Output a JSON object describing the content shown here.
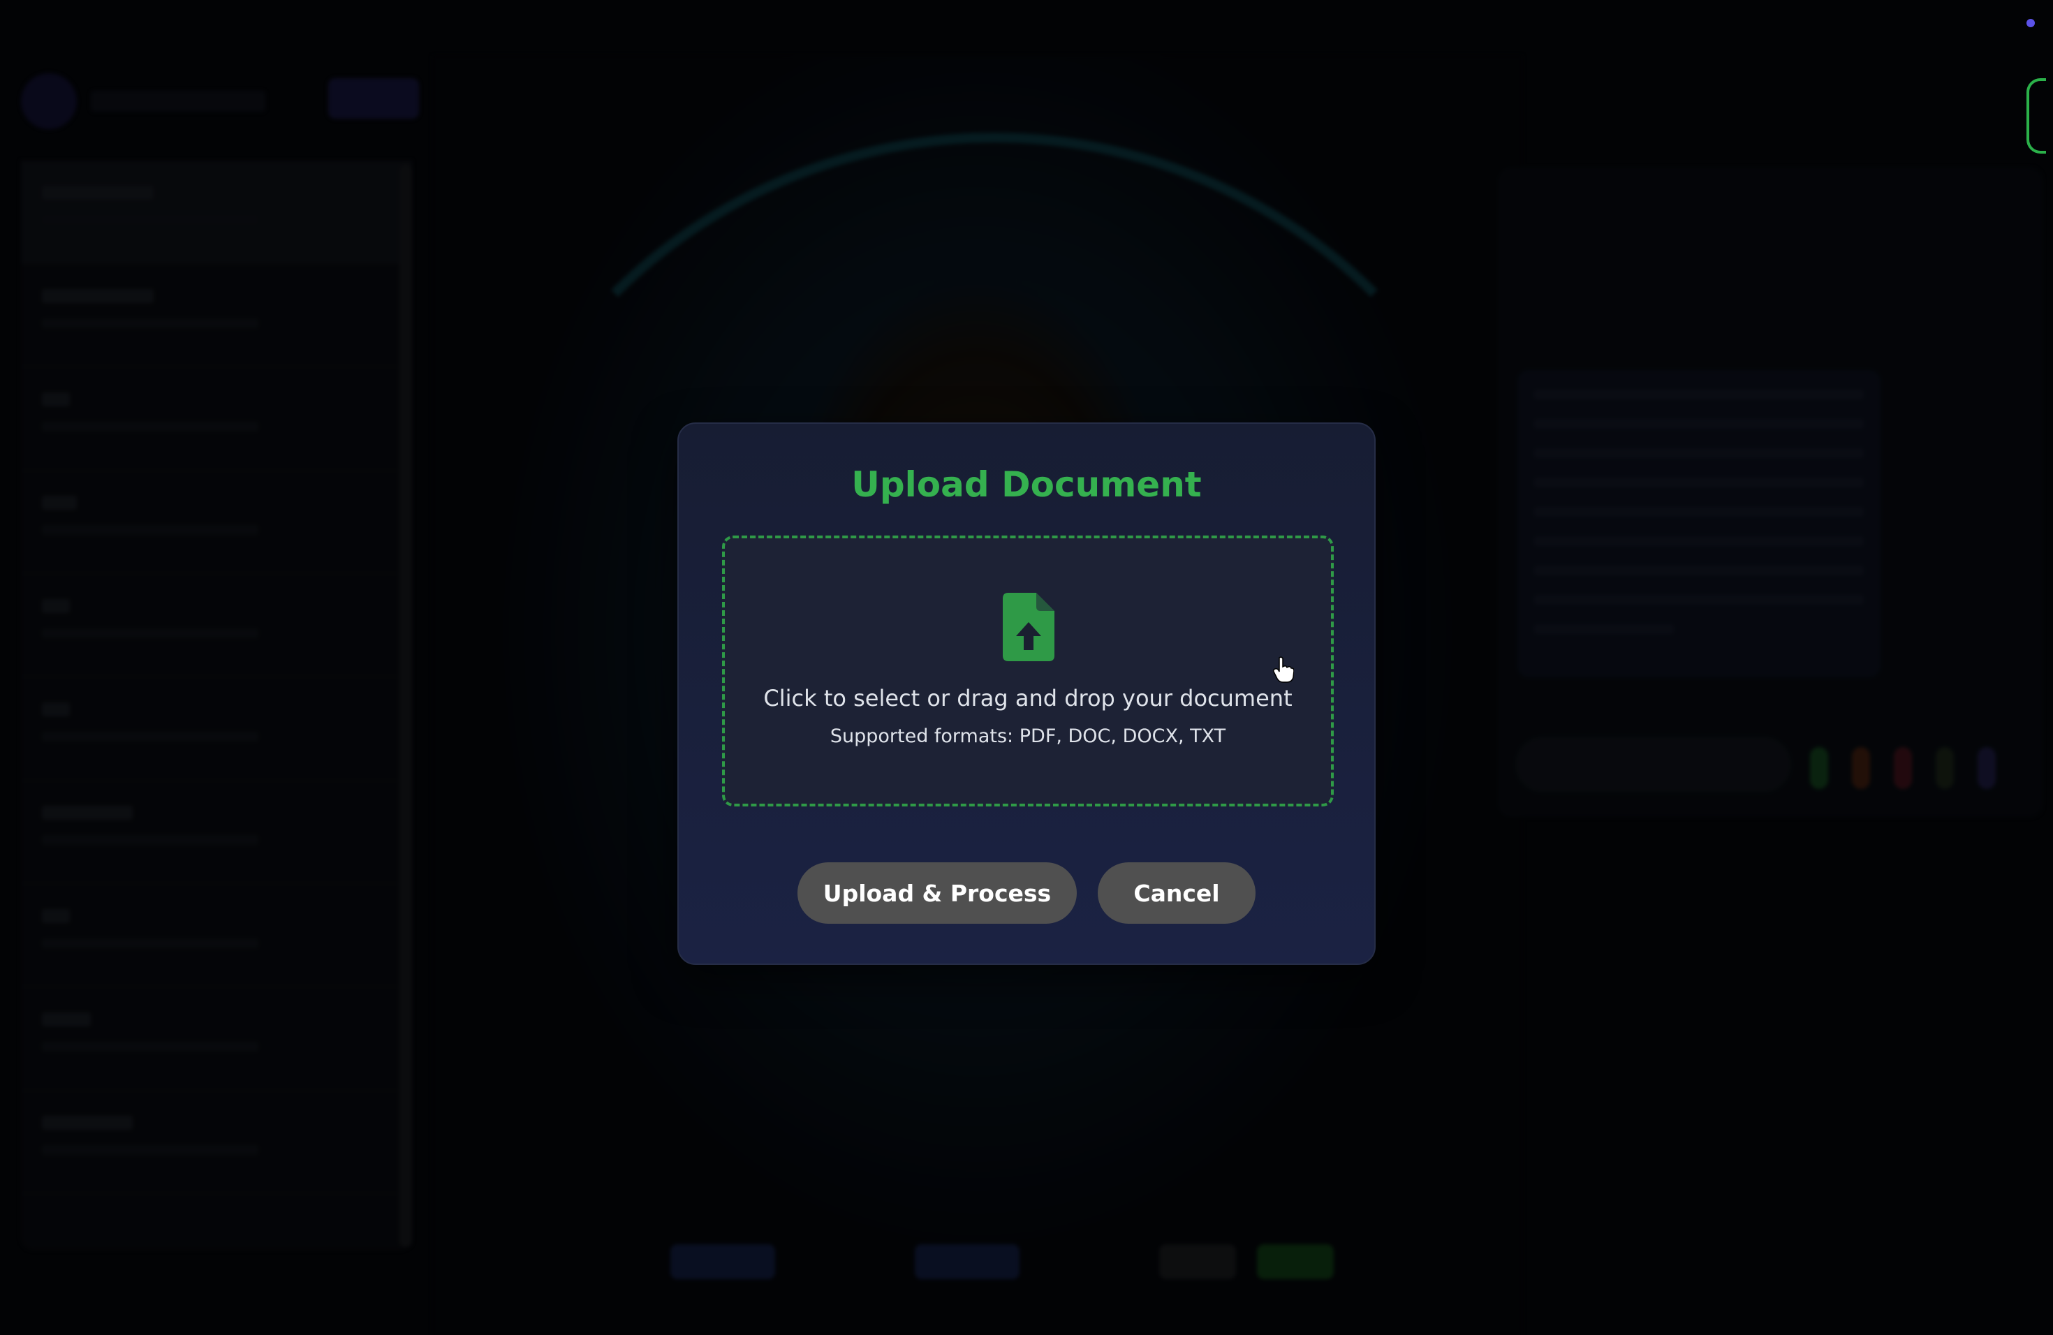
{
  "modal": {
    "title": "Upload Document",
    "dropzone": {
      "instruction": "Click to select or drag and drop your document",
      "formats": "Supported formats: PDF, DOC, DOCX, TXT",
      "icon": "file-upload-icon"
    },
    "buttons": {
      "upload_label": "Upload & Process",
      "cancel_label": "Cancel"
    }
  },
  "colors": {
    "accent_green": "#35b14f",
    "modal_bg": "#1b2243",
    "button_bg": "#505050"
  }
}
